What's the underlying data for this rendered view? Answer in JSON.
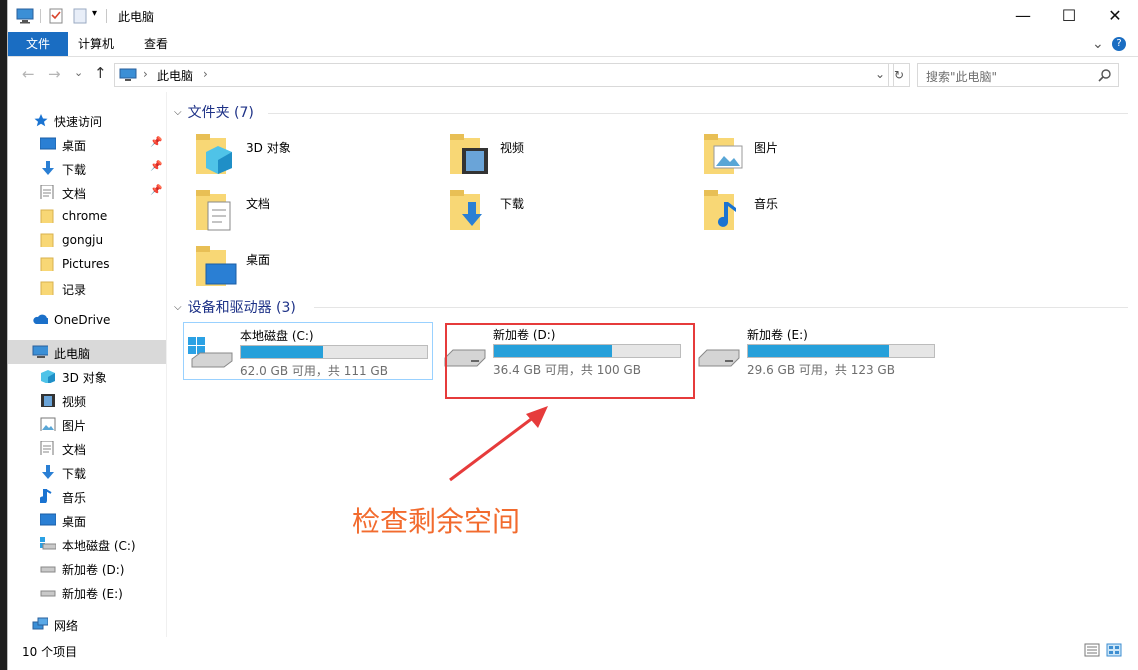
{
  "window": {
    "title": "此电脑",
    "controls": {
      "minimize": "—",
      "maximize": "☐",
      "close": "✕"
    }
  },
  "ribbon": {
    "tabs": [
      {
        "label": "文件",
        "active": true
      },
      {
        "label": "计算机",
        "active": false
      },
      {
        "label": "查看",
        "active": false
      }
    ],
    "collapse_glyph": "⌄",
    "help_glyph": "?"
  },
  "address": {
    "back": "←",
    "forward": "→",
    "recent": "⌄",
    "up": "↑",
    "crumb_arrow": "›",
    "path": "此电脑",
    "dropdown": "⌄",
    "refresh": "↻",
    "search_placeholder": "搜索\"此电脑\"",
    "search_icon": "search-icon"
  },
  "nav": {
    "items": [
      {
        "label": "快速访问",
        "icon": "star-icon",
        "pinned": false
      },
      {
        "label": "桌面",
        "icon": "desktop-icon",
        "pinned": true
      },
      {
        "label": "下载",
        "icon": "download-icon",
        "pinned": true
      },
      {
        "label": "文档",
        "icon": "document-icon",
        "pinned": true
      },
      {
        "label": "chrome",
        "icon": "folder-icon",
        "pinned": false
      },
      {
        "label": "gongju",
        "icon": "folder-icon",
        "pinned": false
      },
      {
        "label": "Pictures",
        "icon": "folder-icon",
        "pinned": false
      },
      {
        "label": "记录",
        "icon": "folder-icon",
        "pinned": false
      },
      {
        "label": "OneDrive",
        "icon": "cloud-icon",
        "pinned": false
      },
      {
        "label": "此电脑",
        "icon": "computer-icon",
        "pinned": false,
        "selected": true
      },
      {
        "label": "3D 对象",
        "icon": "3d-icon",
        "pinned": false
      },
      {
        "label": "视频",
        "icon": "video-icon",
        "pinned": false
      },
      {
        "label": "图片",
        "icon": "picture-icon",
        "pinned": false
      },
      {
        "label": "文档",
        "icon": "document-icon",
        "pinned": false
      },
      {
        "label": "下载",
        "icon": "download-icon",
        "pinned": false
      },
      {
        "label": "音乐",
        "icon": "music-icon",
        "pinned": false
      },
      {
        "label": "桌面",
        "icon": "desktop-icon",
        "pinned": false
      },
      {
        "label": "本地磁盘 (C:)",
        "icon": "system-drive-icon",
        "pinned": false
      },
      {
        "label": "新加卷 (D:)",
        "icon": "drive-icon",
        "pinned": false
      },
      {
        "label": "新加卷 (E:)",
        "icon": "drive-icon",
        "pinned": false
      },
      {
        "label": "网络",
        "icon": "network-icon",
        "pinned": false
      }
    ],
    "pin_glyph": "📌"
  },
  "folders_section": {
    "header": "文件夹 (7)",
    "items": [
      {
        "label": "3D 对象",
        "icon": "3d-folder-icon"
      },
      {
        "label": "视频",
        "icon": "video-folder-icon"
      },
      {
        "label": "图片",
        "icon": "picture-folder-icon"
      },
      {
        "label": "文档",
        "icon": "document-folder-icon"
      },
      {
        "label": "下载",
        "icon": "download-folder-icon"
      },
      {
        "label": "音乐",
        "icon": "music-folder-icon"
      },
      {
        "label": "桌面",
        "icon": "desktop-folder-icon"
      }
    ]
  },
  "drives_section": {
    "header": "设备和驱动器 (3)",
    "drives": [
      {
        "name": "本地磁盘 (C:)",
        "info": "62.0 GB 可用，共 111 GB",
        "used_fraction": 0.44,
        "system": true,
        "selected": true
      },
      {
        "name": "新加卷 (D:)",
        "info": "36.4 GB 可用，共 100 GB",
        "used_fraction": 0.636,
        "system": false,
        "selected": false
      },
      {
        "name": "新加卷 (E:)",
        "info": "29.6 GB 可用，共 123 GB",
        "used_fraction": 0.76,
        "system": false,
        "selected": false
      }
    ]
  },
  "status": {
    "count": "10 个项目"
  },
  "annotation": {
    "text": "检查剩余空间",
    "color": "#f26b2e",
    "box_color": "#e63b3b"
  },
  "colors": {
    "accent": "#1a6dc2",
    "bar_fill": "#26a0da",
    "section_header": "#1e3287",
    "folder_yellow": "#f8d775"
  }
}
